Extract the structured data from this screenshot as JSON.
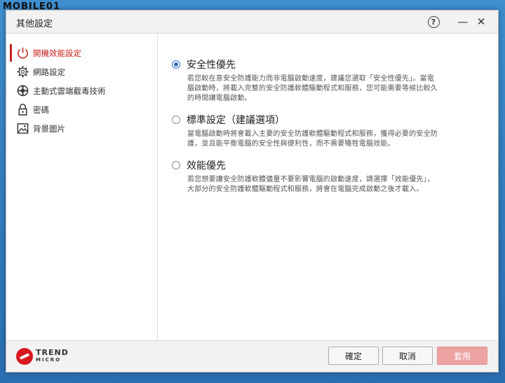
{
  "watermark": "MOBILE01",
  "window": {
    "title": "其他設定",
    "help_label": "?",
    "minimize_label": "—",
    "close_label": "✕"
  },
  "sidebar": {
    "items": [
      {
        "label": "開機效能設定",
        "icon": "power-icon",
        "active": true
      },
      {
        "label": "網路設定",
        "icon": "gear-icon",
        "active": false
      },
      {
        "label": "主動式雲端截毒技術",
        "icon": "globe-icon",
        "active": false
      },
      {
        "label": "密碼",
        "icon": "lock-icon",
        "active": false
      },
      {
        "label": "背景圖片",
        "icon": "picture-icon",
        "active": false
      }
    ]
  },
  "options": [
    {
      "title": "安全性優先",
      "checked": true,
      "desc": "若您較在意安全防護能力而非電腦啟動速度，建議您選取「安全性優先」。當電\n腦啟動時，將載入完整的安全防護軟體驅動程式和服務，您可能需要等候比較久\n的時間讓電腦啟動。"
    },
    {
      "title": "標準設定（建議選項）",
      "checked": false,
      "desc": "當電腦啟動時將會載入主要的安全防護軟體驅動程式和服務，獲得必要的安全防\n護，並且能平衡電腦的安全性與便利性，而不需要犧牲電腦效能。"
    },
    {
      "title": "效能優先",
      "checked": false,
      "desc": "若您想要讓安全防護軟體儘量不要影響電腦的啟動速度，請選擇「效能優先」，\n大部分的安全防護軟體驅動程式和服務，將會在電腦完成啟動之後才載入。"
    }
  ],
  "footer": {
    "logo_line1": "TREND",
    "logo_line2": "MICRO",
    "ok_label": "確定",
    "cancel_label": "取消",
    "apply_label": "套用"
  },
  "colors": {
    "accent": "#c8231f",
    "radio": "#2d6fb8",
    "apply_disabled": "#eea3a3"
  }
}
